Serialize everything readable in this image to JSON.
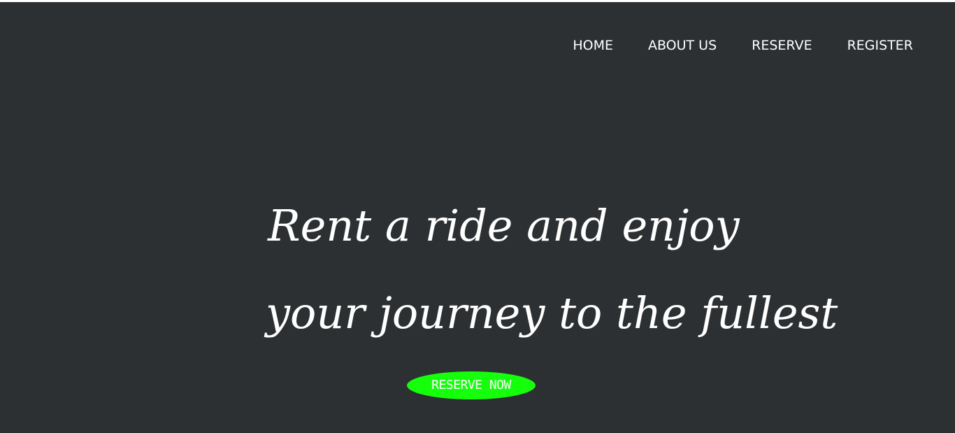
{
  "nav": {
    "items": [
      {
        "label": "HOME"
      },
      {
        "label": "ABOUT US"
      },
      {
        "label": "RESERVE"
      },
      {
        "label": "REGISTER"
      }
    ]
  },
  "hero": {
    "line1": "Rent a ride and enjoy",
    "line2": "your journey to the fullest",
    "cta_label": "RESERVE NOW"
  },
  "colors": {
    "background": "#2d3032",
    "text": "#ffffff",
    "cta_background": "#15ff0d"
  }
}
